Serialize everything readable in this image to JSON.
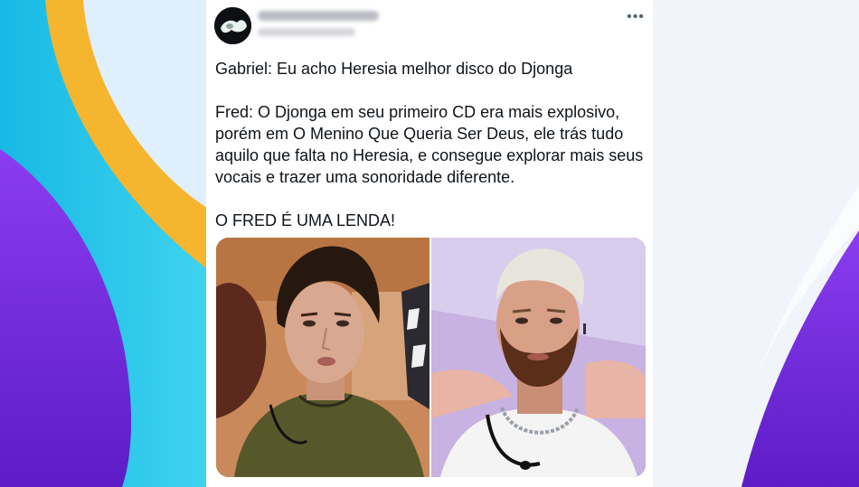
{
  "tweet": {
    "more_icon": "more-horizontal-icon",
    "paragraphs": [
      "Gabriel: Eu acho Heresia melhor disco do Djonga",
      "Fred: O Djonga em seu primeiro CD era mais explosivo, porém em O Menino Que Queria Ser Deus, ele trás tudo aquilo que falta no Heresia, e consegue explorar mais seus vocais e trazer uma sonoridade diferente.",
      "O FRED É UMA LENDA!"
    ]
  },
  "colors": {
    "accent_orange": "#f6b52e",
    "accent_cyan": "#1ec3e6",
    "accent_purple": "#7a2fdc",
    "text_primary": "#0f1419",
    "icon_gray": "#536471"
  }
}
